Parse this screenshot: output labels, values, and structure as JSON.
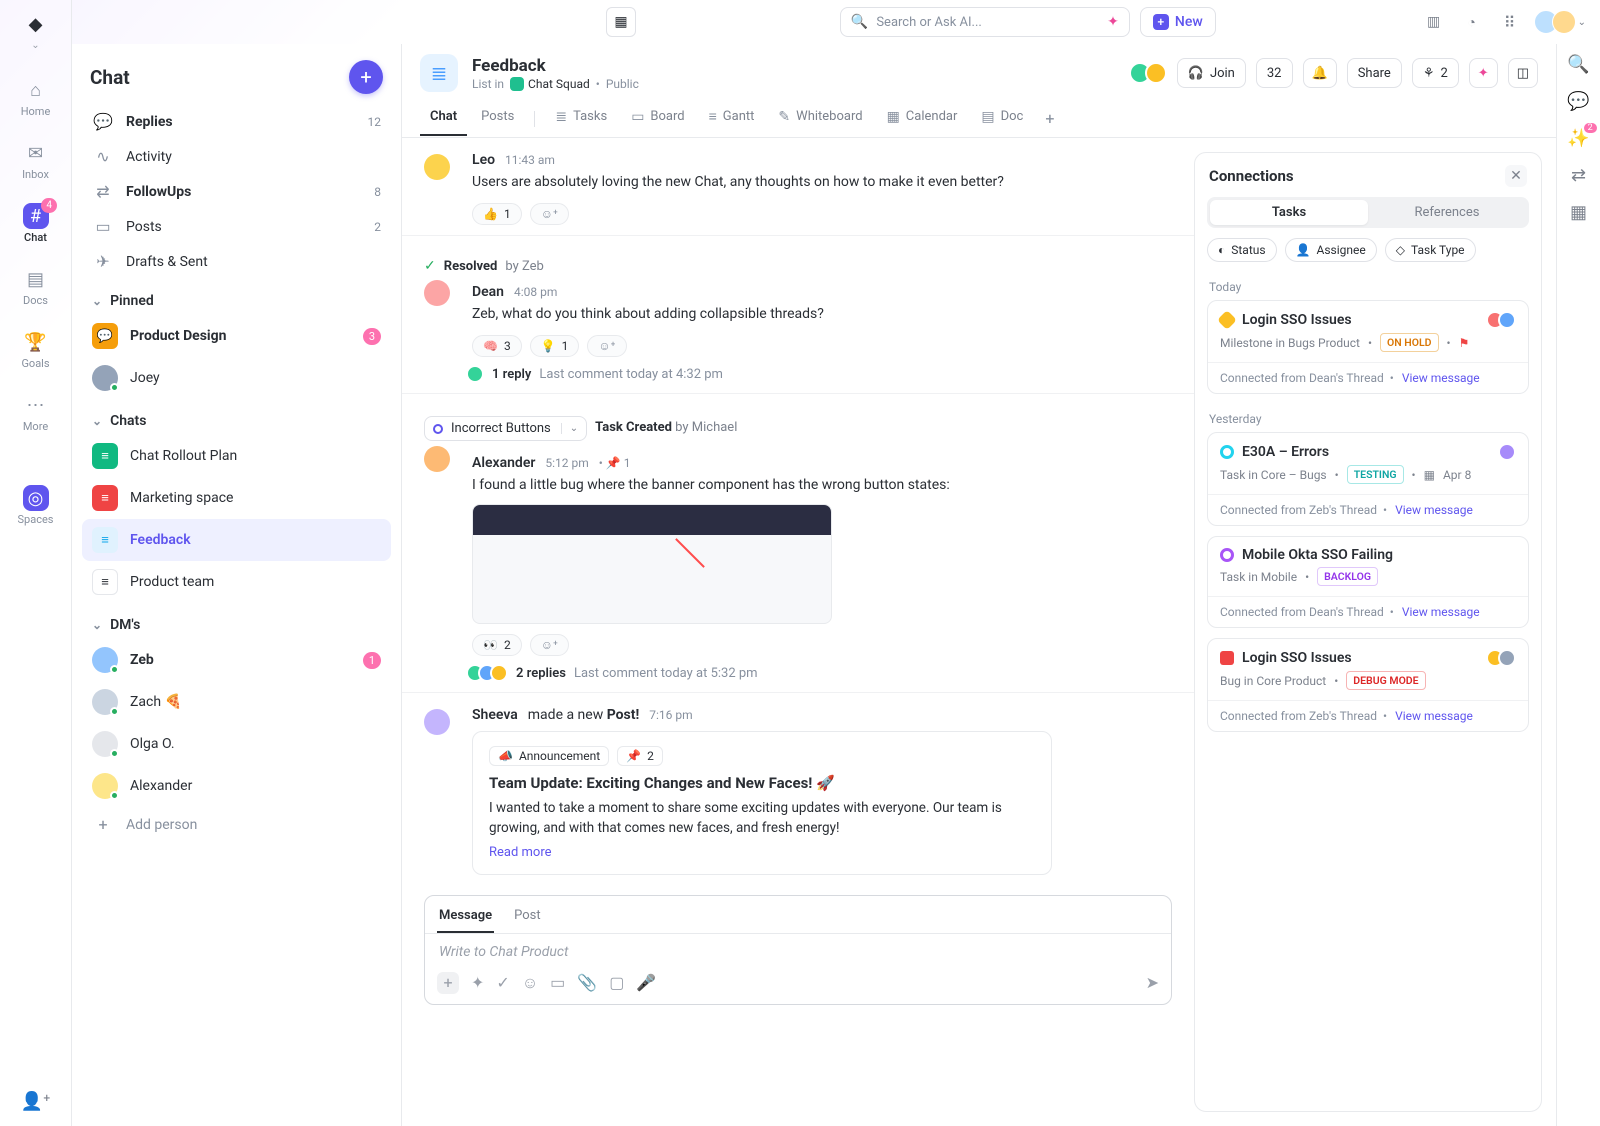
{
  "topbar": {
    "search_placeholder": "Search or Ask AI...",
    "new_label": "New"
  },
  "rail": {
    "items": [
      {
        "label": "Home",
        "icon": "⌂"
      },
      {
        "label": "Inbox",
        "icon": "✉"
      },
      {
        "label": "Chat",
        "icon": "#",
        "active": true,
        "badge": "4"
      },
      {
        "label": "Docs",
        "icon": "▤"
      },
      {
        "label": "Goals",
        "icon": "🏆"
      },
      {
        "label": "More",
        "icon": "⋯"
      }
    ],
    "spaces_label": "Spaces"
  },
  "chat_side": {
    "title": "Chat",
    "nav": [
      {
        "icon": "↩",
        "label": "Replies",
        "count": "12",
        "bold": true
      },
      {
        "icon": "∿",
        "label": "Activity"
      },
      {
        "icon": "⇄",
        "label": "FollowUps",
        "count": "8",
        "bold": true
      },
      {
        "icon": "▭",
        "label": "Posts",
        "count": "2"
      },
      {
        "icon": "✎",
        "label": "Drafts & Sent"
      }
    ],
    "pinned_label": "Pinned",
    "pinned": [
      {
        "label": "Product Design",
        "badge": "3",
        "color": "#f59e0b"
      },
      {
        "label": "Joey",
        "type": "dm",
        "color": "#94a3b8"
      }
    ],
    "chats_label": "Chats",
    "chats": [
      {
        "label": "Chat Rollout Plan",
        "color": "#10b981"
      },
      {
        "label": "Marketing space",
        "color": "#ef4444"
      },
      {
        "label": "Feedback",
        "active": true,
        "color": "#60a5fa"
      },
      {
        "label": "Product team",
        "color": "#fff"
      }
    ],
    "dms_label": "DM's",
    "dms": [
      {
        "label": "Zeb",
        "badge": "1",
        "bold": true,
        "color": "#93c5fd"
      },
      {
        "label": "Zach",
        "emoji": "🍕",
        "color": "#cbd5e1"
      },
      {
        "label": "Olga O.",
        "color": "#e5e7eb"
      },
      {
        "label": "Alexander",
        "color": "#fde68a"
      }
    ],
    "add_person": "Add person"
  },
  "header": {
    "title": "Feedback",
    "list_in": "List in",
    "squad": "Chat Squad",
    "visibility": "Public",
    "join": "Join",
    "count": "32",
    "share": "Share",
    "shared": "2",
    "view_tabs": [
      {
        "label": "Chat",
        "active": true
      },
      {
        "label": "Posts"
      }
    ],
    "views": [
      {
        "icon": "≣",
        "label": "Tasks"
      },
      {
        "icon": "▭",
        "label": "Board"
      },
      {
        "icon": "≡",
        "label": "Gantt"
      },
      {
        "icon": "✎",
        "label": "Whiteboard"
      },
      {
        "icon": "▦",
        "label": "Calendar"
      },
      {
        "icon": "▤",
        "label": "Doc"
      }
    ]
  },
  "thread": [
    {
      "author": "Leo",
      "time": "11:43 am",
      "text": "Users are absolutely loving the new Chat, any thoughts on how to make it even better?",
      "reactions": [
        {
          "emoji": "👍",
          "count": "1"
        }
      ]
    },
    {
      "resolved_by": "Zeb",
      "author": "Dean",
      "time": "4:08 pm",
      "text": "Zeb, what do you think about adding collapsible threads?",
      "reactions": [
        {
          "emoji": "🧠",
          "count": "3"
        },
        {
          "emoji": "💡",
          "count": "1"
        }
      ],
      "thread": {
        "replies": "1 reply",
        "last": "Last comment today at 4:32 pm"
      }
    },
    {
      "task": {
        "name": "Incorrect Buttons",
        "created_label": "Task Created",
        "created_by": "by Michael"
      },
      "author": "Alexander",
      "time": "5:12 pm",
      "pinned": "1",
      "text": "I found a little bug where the banner component has the wrong button states:",
      "has_image": true,
      "reactions": [
        {
          "emoji": "👀",
          "count": "2"
        }
      ],
      "thread": {
        "replies": "2 replies",
        "last": "Last comment today at 5:32 pm"
      }
    },
    {
      "post": true,
      "author": "Sheeva",
      "made_new": "made a new",
      "post_label": "Post!",
      "time": "7:16 pm",
      "tag": "Announcement",
      "pinned": "2",
      "title": "Team Update: Exciting Changes and New Faces! 🚀",
      "body": "I wanted to take a moment to share some exciting updates with everyone. Our team is growing, and with that comes new faces, and fresh energy!",
      "read_more": "Read more"
    }
  ],
  "composer": {
    "tabs": [
      "Message",
      "Post"
    ],
    "placeholder": "Write to Chat Product"
  },
  "connections": {
    "title": "Connections",
    "seg": [
      "Tasks",
      "References"
    ],
    "filters": [
      "Status",
      "Assignee",
      "Task Type"
    ],
    "groups": [
      {
        "day": "Today",
        "cards": [
          {
            "status": "yellow",
            "title": "Login SSO Issues",
            "sub": "Milestone in Bugs Product",
            "tag": "ON HOLD",
            "tag_cls": "hold",
            "flag": true,
            "avatars": 2,
            "from": "Connected from Dean's Thread",
            "view": "View message"
          }
        ]
      },
      {
        "day": "Yesterday",
        "cards": [
          {
            "status": "cyan",
            "title": "E30A – Errors",
            "sub": "Task in Core – Bugs",
            "tag": "TESTING",
            "tag_cls": "test",
            "date": "Apr 8",
            "avatars": 1,
            "from": "Connected from Zeb's Thread",
            "view": "View message"
          },
          {
            "status": "purple",
            "title": "Mobile Okta SSO Failing",
            "sub": "Task in Mobile",
            "tag": "BACKLOG",
            "tag_cls": "back",
            "avatars": 0,
            "from": "Connected from Dean's Thread",
            "view": "View message"
          },
          {
            "status": "bug",
            "title": "Login SSO Issues",
            "sub": "Bug in Core Product",
            "tag": "DEBUG MODE",
            "tag_cls": "debug",
            "avatars": 2,
            "from": "Connected from Zeb's Thread",
            "view": "View message"
          }
        ]
      }
    ]
  }
}
